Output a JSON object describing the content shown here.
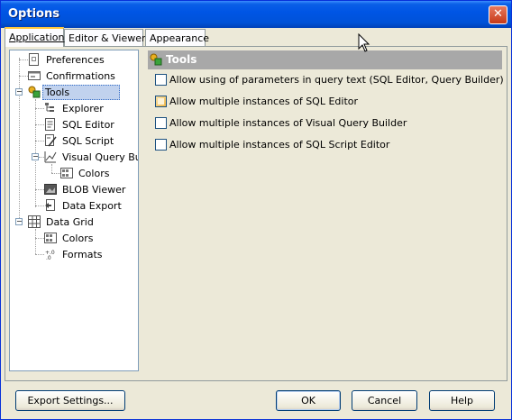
{
  "window": {
    "title": "Options",
    "close_label": "✕"
  },
  "tabs": [
    {
      "label": "Application",
      "active": true
    },
    {
      "label": "Editor & Viewers",
      "active": false
    },
    {
      "label": "Appearance",
      "active": false
    }
  ],
  "tree": [
    {
      "label": "Preferences",
      "icon": "preferences-icon"
    },
    {
      "label": "Confirmations",
      "icon": "confirmations-icon"
    },
    {
      "label": "Tools",
      "icon": "tools-icon",
      "selected": true,
      "expanded": true
    },
    {
      "label": "Explorer",
      "icon": "explorer-icon"
    },
    {
      "label": "SQL Editor",
      "icon": "sql-editor-icon"
    },
    {
      "label": "SQL Script",
      "icon": "sql-script-icon"
    },
    {
      "label": "Visual Query Builder",
      "icon": "query-builder-icon",
      "expanded": true
    },
    {
      "label": "Colors",
      "icon": "colors-icon"
    },
    {
      "label": "BLOB Viewer",
      "icon": "blob-viewer-icon"
    },
    {
      "label": "Data Export",
      "icon": "data-export-icon"
    },
    {
      "label": "Data Grid",
      "icon": "data-grid-icon",
      "expanded": true
    },
    {
      "label": "Colors",
      "icon": "colors-icon"
    },
    {
      "label": "Formats",
      "icon": "formats-icon"
    }
  ],
  "panel": {
    "title": "Tools",
    "options": [
      {
        "label": "Allow using of parameters in query text (SQL Editor, Query Builder)",
        "checked": false
      },
      {
        "label": "Allow multiple instances of SQL Editor",
        "checked": false
      },
      {
        "label": "Allow multiple instances of Visual Query Builder",
        "checked": false
      },
      {
        "label": "Allow multiple instances of SQL Script Editor",
        "checked": false
      }
    ]
  },
  "buttons": {
    "export": "Export Settings...",
    "ok": "OK",
    "cancel": "Cancel",
    "help": "Help"
  },
  "colors": {
    "titlebar": "#0055e5",
    "header": "#a8a8a8",
    "selection": "#c1d2ee"
  }
}
